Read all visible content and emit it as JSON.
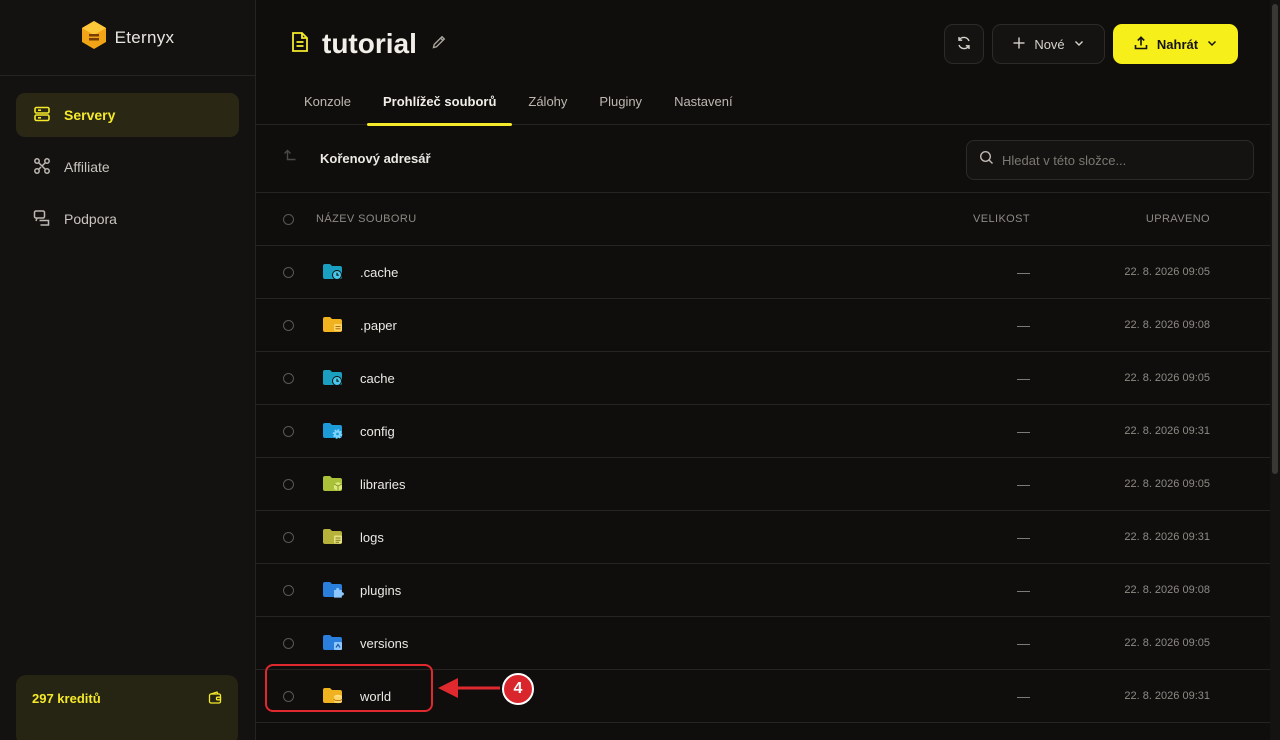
{
  "brand": {
    "name": "Eternyx"
  },
  "sidebar": {
    "items": [
      {
        "label": "Servery",
        "icon": "server-icon",
        "active": true
      },
      {
        "label": "Affiliate",
        "icon": "affiliate-icon",
        "active": false
      },
      {
        "label": "Podpora",
        "icon": "chat-icon",
        "active": false
      }
    ],
    "credits": {
      "label": "297 kreditů",
      "icon": "wallet-icon"
    }
  },
  "header": {
    "title": "tutorial",
    "new_label": "Nové",
    "upload_label": "Nahrát"
  },
  "tabs": [
    {
      "label": "Konzole",
      "active": false
    },
    {
      "label": "Prohlížeč souborů",
      "active": true
    },
    {
      "label": "Zálohy",
      "active": false
    },
    {
      "label": "Pluginy",
      "active": false
    },
    {
      "label": "Nastavení",
      "active": false
    }
  ],
  "pathbar": {
    "label": "Kořenový adresář"
  },
  "search": {
    "placeholder": "Hledat v této složce..."
  },
  "table": {
    "columns": {
      "name": "NÁZEV SOUBORU",
      "size": "VELIKOST",
      "modified": "UPRAVENO"
    },
    "rows": [
      {
        "name": ".cache",
        "size": "—",
        "modified": "22. 8. 2026 09:05",
        "icon": "folder-clock-icon"
      },
      {
        "name": ".paper",
        "size": "—",
        "modified": "22. 8. 2026 09:08",
        "icon": "folder-icon"
      },
      {
        "name": "cache",
        "size": "—",
        "modified": "22. 8. 2026 09:05",
        "icon": "folder-clock-icon"
      },
      {
        "name": "config",
        "size": "—",
        "modified": "22. 8. 2026 09:31",
        "icon": "folder-gear-icon"
      },
      {
        "name": "libraries",
        "size": "—",
        "modified": "22. 8. 2026 09:05",
        "icon": "folder-icon"
      },
      {
        "name": "logs",
        "size": "—",
        "modified": "22. 8. 2026 09:31",
        "icon": "folder-icon"
      },
      {
        "name": "plugins",
        "size": "—",
        "modified": "22. 8. 2026 09:08",
        "icon": "folder-puzzle-icon"
      },
      {
        "name": "versions",
        "size": "—",
        "modified": "22. 8. 2026 09:05",
        "icon": "folder-icon"
      },
      {
        "name": "world",
        "size": "—",
        "modified": "22. 8. 2026 09:31",
        "icon": "folder-icon"
      }
    ]
  },
  "annotation": {
    "badge": "4"
  },
  "colors": {
    "accent": "#f5ea2a",
    "annotation": "#e0282f"
  }
}
